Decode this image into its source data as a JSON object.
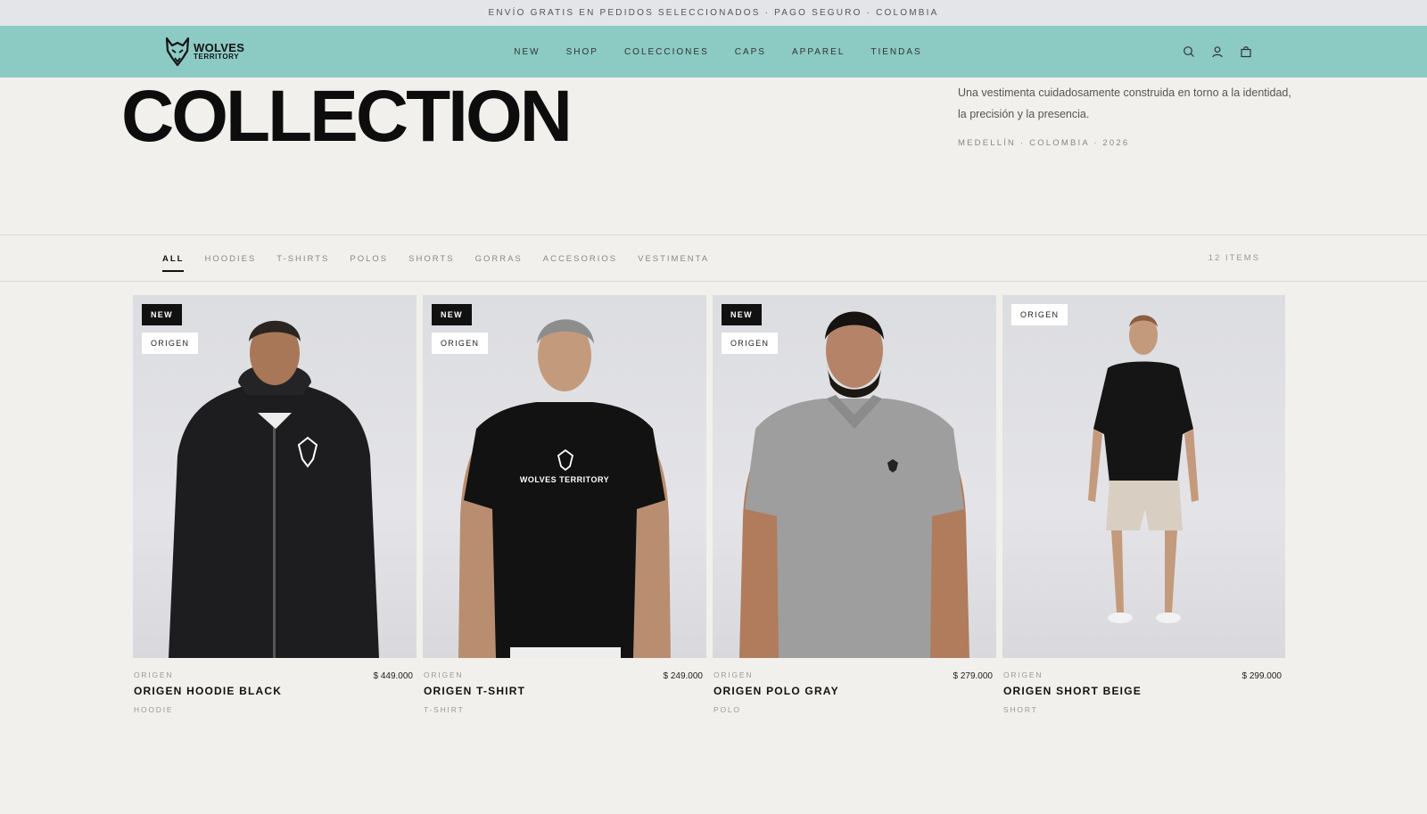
{
  "announcement": "ENVÍO GRATIS EN PEDIDOS SELECCIONADOS · PAGO SEGURO · COLOMBIA",
  "brand": {
    "line1": "WOLVES",
    "line2": "TERRITORY"
  },
  "nav": [
    "NEW",
    "SHOP",
    "COLECCIONES",
    "CAPS",
    "APPAREL",
    "TIENDAS"
  ],
  "header_icons": [
    "search-icon",
    "user-icon",
    "bag-icon"
  ],
  "hero": {
    "title": "COLLECTION",
    "description": "Una vestimenta cuidadosamente construida en torno a la identidad, la precisión y la presencia.",
    "meta": "MEDELLÍN · COLOMBIA · 2026"
  },
  "filters": {
    "tabs": [
      "ALL",
      "HOODIES",
      "T-SHIRTS",
      "POLOS",
      "SHORTS",
      "GORRAS",
      "ACCESORIOS",
      "VESTIMENTA"
    ],
    "active": "ALL",
    "count": "12 ITEMS"
  },
  "products": [
    {
      "badge_new": "NEW",
      "tag": "ORIGEN",
      "collection": "ORIGEN",
      "name": "ORIGEN HOODIE BLACK",
      "price": "$ 449.000",
      "category": "HOODIE"
    },
    {
      "badge_new": "NEW",
      "tag": "ORIGEN",
      "collection": "ORIGEN",
      "name": "ORIGEN T-SHIRT",
      "price": "$ 249.000",
      "category": "T-SHIRT",
      "shirt_text": "WOLVES TERRITORY"
    },
    {
      "badge_new": "NEW",
      "tag": "ORIGEN",
      "collection": "ORIGEN",
      "name": "ORIGEN POLO GRAY",
      "price": "$ 279.000",
      "category": "POLO"
    },
    {
      "tag": "ORIGEN",
      "collection": "ORIGEN",
      "name": "ORIGEN SHORT BEIGE",
      "price": "$ 299.000",
      "category": "SHORT"
    }
  ],
  "colors": {
    "header_bg": "#8ccac4",
    "page_bg": "#f2f0ec",
    "announce_bg": "#e3e5e8",
    "badge_bg": "#111111"
  }
}
